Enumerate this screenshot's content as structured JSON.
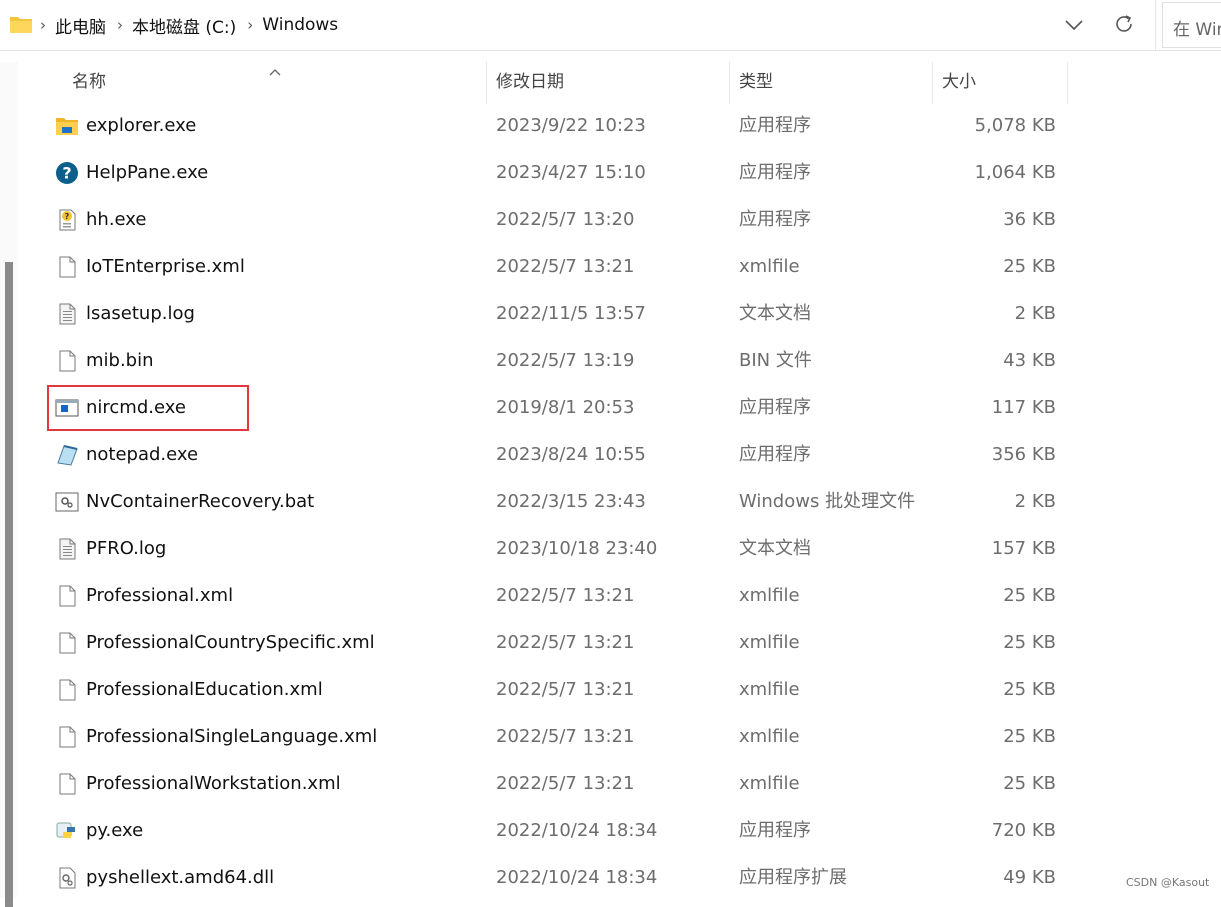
{
  "address": {
    "crumbs": [
      "此电脑",
      "本地磁盘 (C:)",
      "Windows"
    ],
    "search_placeholder": "在 Windows 中搜索"
  },
  "columns": {
    "name": "名称",
    "date": "修改日期",
    "type": "类型",
    "size": "大小"
  },
  "files": [
    {
      "name": "explorer.exe",
      "date": "2023/9/22 10:23",
      "type": "应用程序",
      "size": "5,078 KB",
      "icon": "explorer-icon"
    },
    {
      "name": "HelpPane.exe",
      "date": "2023/4/27 15:10",
      "type": "应用程序",
      "size": "1,064 KB",
      "icon": "help-icon"
    },
    {
      "name": "hh.exe",
      "date": "2022/5/7 13:20",
      "type": "应用程序",
      "size": "36 KB",
      "icon": "help-file-icon"
    },
    {
      "name": "IoTEnterprise.xml",
      "date": "2022/5/7 13:21",
      "type": "xmlfile",
      "size": "25 KB",
      "icon": "document-icon"
    },
    {
      "name": "lsasetup.log",
      "date": "2022/11/5 13:57",
      "type": "文本文档",
      "size": "2 KB",
      "icon": "text-file-icon"
    },
    {
      "name": "mib.bin",
      "date": "2022/5/7 13:19",
      "type": "BIN 文件",
      "size": "43 KB",
      "icon": "document-icon"
    },
    {
      "name": "nircmd.exe",
      "date": "2019/8/1 20:53",
      "type": "应用程序",
      "size": "117 KB",
      "icon": "application-icon"
    },
    {
      "name": "notepad.exe",
      "date": "2023/8/24 10:55",
      "type": "应用程序",
      "size": "356 KB",
      "icon": "notepad-icon"
    },
    {
      "name": "NvContainerRecovery.bat",
      "date": "2022/3/15 23:43",
      "type": "Windows 批处理文件",
      "size": "2 KB",
      "icon": "batch-file-icon"
    },
    {
      "name": "PFRO.log",
      "date": "2023/10/18 23:40",
      "type": "文本文档",
      "size": "157 KB",
      "icon": "text-file-icon"
    },
    {
      "name": "Professional.xml",
      "date": "2022/5/7 13:21",
      "type": "xmlfile",
      "size": "25 KB",
      "icon": "document-icon"
    },
    {
      "name": "ProfessionalCountrySpecific.xml",
      "date": "2022/5/7 13:21",
      "type": "xmlfile",
      "size": "25 KB",
      "icon": "document-icon"
    },
    {
      "name": "ProfessionalEducation.xml",
      "date": "2022/5/7 13:21",
      "type": "xmlfile",
      "size": "25 KB",
      "icon": "document-icon"
    },
    {
      "name": "ProfessionalSingleLanguage.xml",
      "date": "2022/5/7 13:21",
      "type": "xmlfile",
      "size": "25 KB",
      "icon": "document-icon"
    },
    {
      "name": "ProfessionalWorkstation.xml",
      "date": "2022/5/7 13:21",
      "type": "xmlfile",
      "size": "25 KB",
      "icon": "document-icon"
    },
    {
      "name": "py.exe",
      "date": "2022/10/24 18:34",
      "type": "应用程序",
      "size": "720 KB",
      "icon": "python-icon"
    },
    {
      "name": "pyshellext.amd64.dll",
      "date": "2022/10/24 18:34",
      "type": "应用程序扩展",
      "size": "49 KB",
      "icon": "dll-file-icon"
    }
  ],
  "watermark": "CSDN @Kasout",
  "colors": {
    "highlight": "#e0383c",
    "scrollbar": "#8a8a8a"
  }
}
